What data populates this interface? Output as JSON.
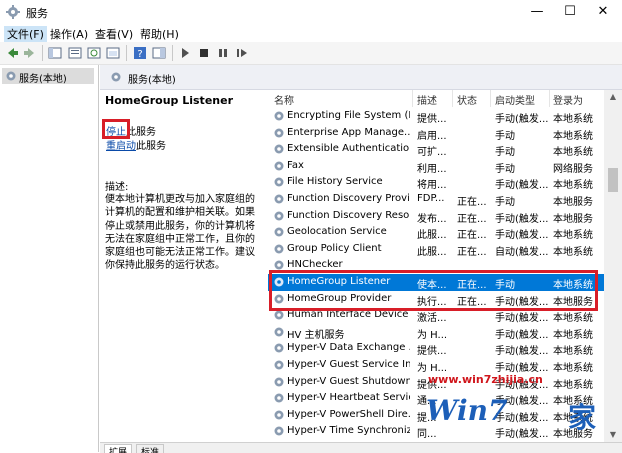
{
  "window": {
    "title": "服务",
    "controls": {
      "minimize": "—",
      "maximize": "☐",
      "close": "✕"
    }
  },
  "menu": [
    "文件(F)",
    "操作(A)",
    "查看(V)",
    "帮助(H)"
  ],
  "left_pane": {
    "tree_item": "服务(本地)"
  },
  "pane_header": "服务(本地)",
  "detail": {
    "service_name": "HomeGroup Listener",
    "stop_link": "停止",
    "stop_suffix": "此服务",
    "restart_link": "重启动",
    "restart_suffix": "此服务",
    "description_label": "描述:",
    "description": "便本地计算机更改与加入家庭组的计算机的配置和维护相关联。如果停止或禁用此服务，你的计算机将无法在家庭组中正常工作，且你的家庭组也可能无法正常工作。建议你保持此服务的运行状态。"
  },
  "columns": {
    "name": "名称",
    "desc": "描述",
    "status": "状态",
    "startup": "启动类型",
    "logon": "登录为"
  },
  "services": [
    {
      "name": "Encrypting File System (E...",
      "desc": "提供...",
      "status": "",
      "startup": "手动(触发...",
      "logon": "本地系统"
    },
    {
      "name": "Enterprise App Manage...",
      "desc": "启用...",
      "status": "",
      "startup": "手动",
      "logon": "本地系统"
    },
    {
      "name": "Extensible Authenticatio...",
      "desc": "可扩...",
      "status": "",
      "startup": "手动",
      "logon": "本地系统"
    },
    {
      "name": "Fax",
      "desc": "利用...",
      "status": "",
      "startup": "手动",
      "logon": "网络服务"
    },
    {
      "name": "File History Service",
      "desc": "将用...",
      "status": "",
      "startup": "手动(触发...",
      "logon": "本地系统"
    },
    {
      "name": "Function Discovery Provi...",
      "desc": "FDP...",
      "status": "正在...",
      "startup": "手动",
      "logon": "本地服务"
    },
    {
      "name": "Function Discovery Reso...",
      "desc": "发布...",
      "status": "正在...",
      "startup": "手动(触发...",
      "logon": "本地服务"
    },
    {
      "name": "Geolocation Service",
      "desc": "此服...",
      "status": "正在...",
      "startup": "手动(触发...",
      "logon": "本地系统"
    },
    {
      "name": "Group Policy Client",
      "desc": "此服...",
      "status": "正在...",
      "startup": "自动(触发...",
      "logon": "本地系统"
    },
    {
      "name": "HNChecker",
      "desc": "",
      "status": "",
      "startup": "",
      "logon": ""
    },
    {
      "name": "HomeGroup Listener",
      "desc": "使本...",
      "status": "正在...",
      "startup": "手动",
      "logon": "本地系统",
      "selected": true
    },
    {
      "name": "HomeGroup Provider",
      "desc": "执行...",
      "status": "正在...",
      "startup": "手动(触发...",
      "logon": "本地服务"
    },
    {
      "name": "Human Interface Device ...",
      "desc": "激活...",
      "status": "",
      "startup": "手动(触发...",
      "logon": "本地系统"
    },
    {
      "name": "HV 主机服务",
      "desc": "为 H...",
      "status": "",
      "startup": "手动(触发...",
      "logon": "本地系统"
    },
    {
      "name": "Hyper-V Data Exchange ...",
      "desc": "提供...",
      "status": "",
      "startup": "手动(触发...",
      "logon": "本地系统"
    },
    {
      "name": "Hyper-V Guest Service In...",
      "desc": "为 H...",
      "status": "",
      "startup": "手动(触发...",
      "logon": "本地系统"
    },
    {
      "name": "Hyper-V Guest Shutdown...",
      "desc": "提供...",
      "status": "",
      "startup": "手动(触发...",
      "logon": "本地系统"
    },
    {
      "name": "Hyper-V Heartbeat Service",
      "desc": "通...",
      "status": "",
      "startup": "手动(触发...",
      "logon": "本地系统"
    },
    {
      "name": "Hyper-V PowerShell Dire...",
      "desc": "提...",
      "status": "",
      "startup": "手动(触发...",
      "logon": "本地系统"
    },
    {
      "name": "Hyper-V Time Synchroniz...",
      "desc": "同...",
      "status": "",
      "startup": "手动(触发...",
      "logon": "本地服务"
    }
  ],
  "tabs": [
    "扩展",
    "标准"
  ],
  "watermark": {
    "url": "www.win7zhijia.cn",
    "brand": "Win7",
    "suffix": "家"
  },
  "colors": {
    "selection": "#0078d7",
    "highlight_box": "#d81e28",
    "link": "#0a4aa8"
  }
}
